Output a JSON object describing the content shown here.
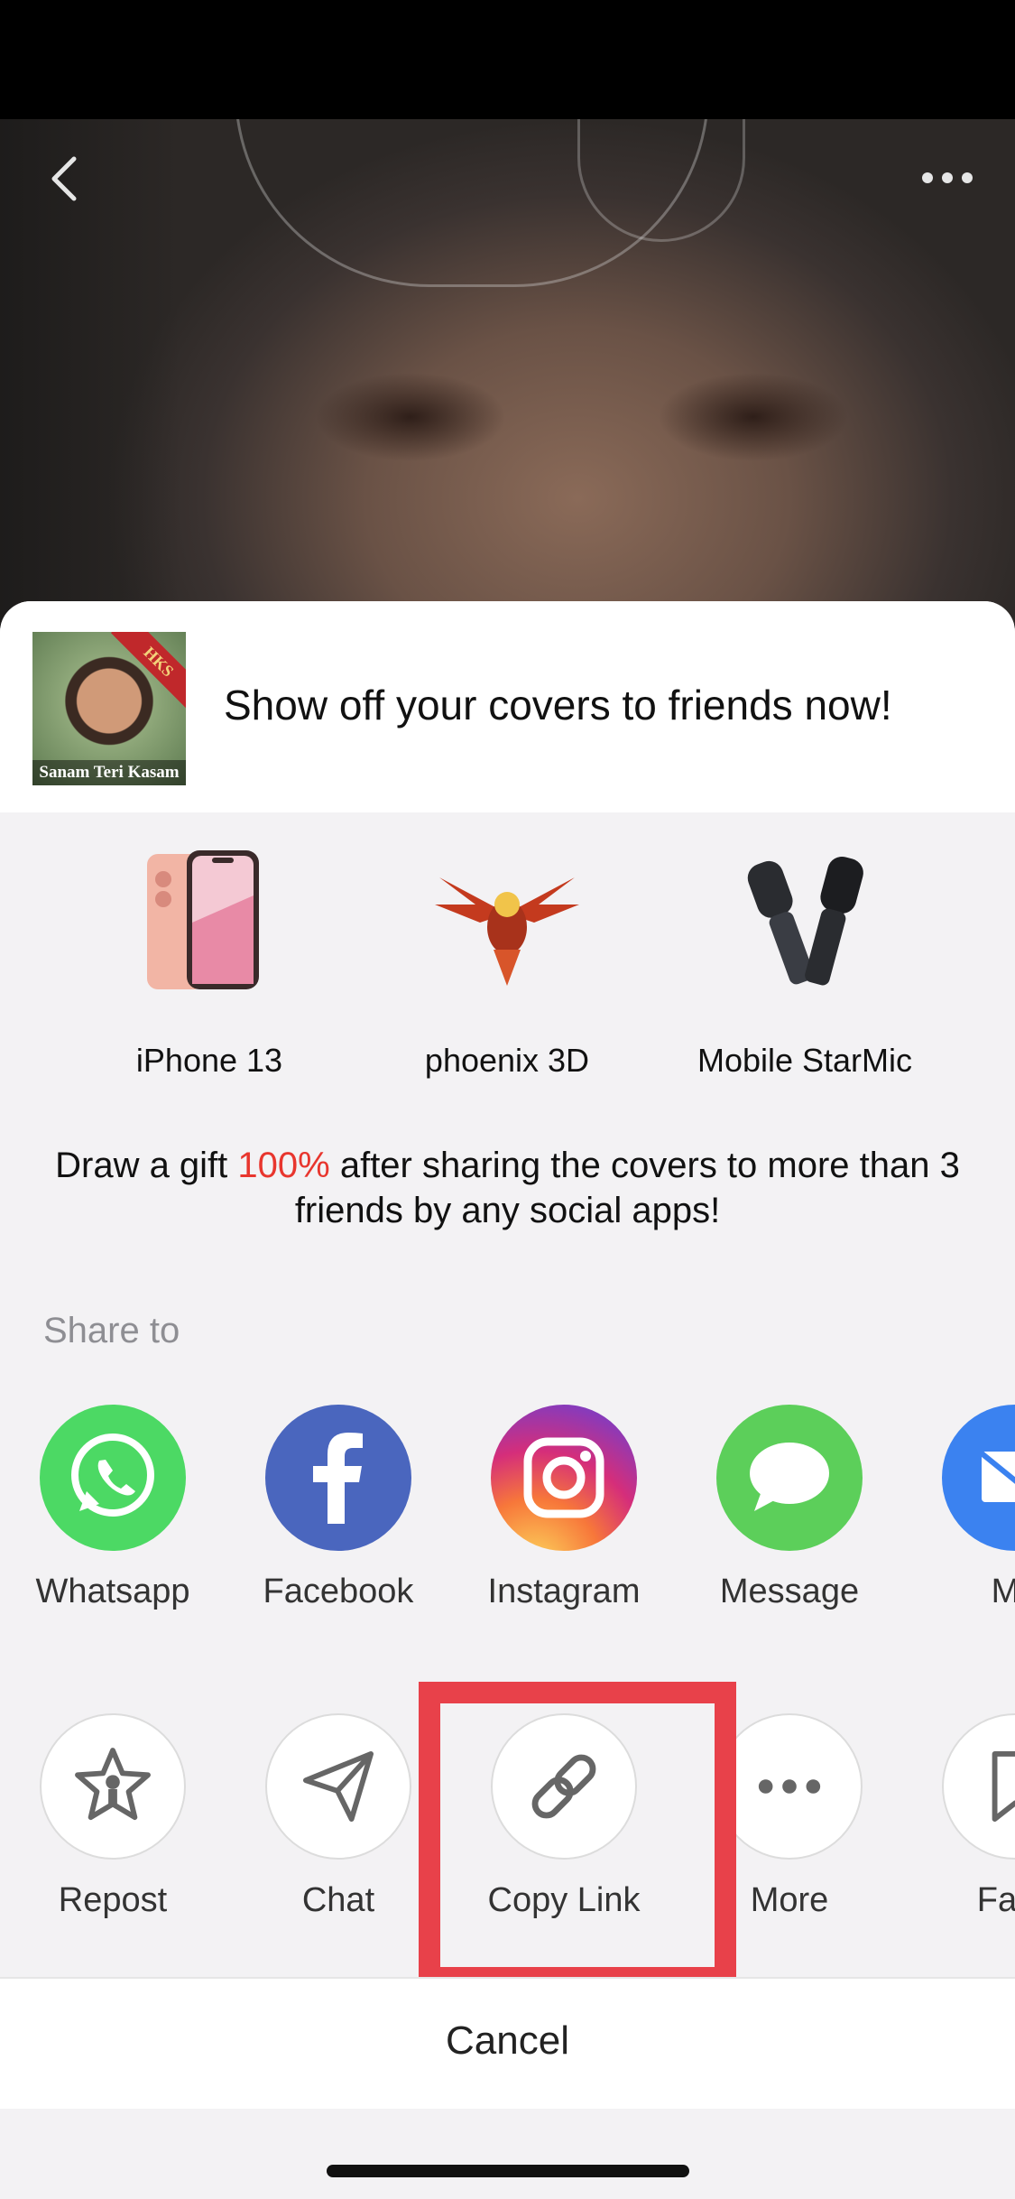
{
  "promo": {
    "cover_ribbon": "HKS",
    "cover_title": "Sanam Teri Kasam",
    "headline": "Show off your covers to friends now!"
  },
  "gifts": [
    {
      "label": "iPhone 13"
    },
    {
      "label": "phoenix 3D"
    },
    {
      "label": "Mobile StarMic"
    }
  ],
  "draw": {
    "prefix": "Draw a gift ",
    "percent": "100%",
    "suffix": " after sharing the covers to more than 3 friends by any social apps!"
  },
  "share_to": "Share to",
  "apps": [
    {
      "label": "Whatsapp",
      "icon": "whatsapp-icon",
      "color": "#4cd964"
    },
    {
      "label": "Facebook",
      "icon": "facebook-icon",
      "color": "#4a66be"
    },
    {
      "label": "Instagram",
      "icon": "instagram-icon",
      "color": "#c13584"
    },
    {
      "label": "Message",
      "icon": "message-icon",
      "color": "#5ccf5a"
    },
    {
      "label": "Ma",
      "icon": "mail-icon",
      "color": "#3b82f0"
    }
  ],
  "actions": [
    {
      "label": "Repost",
      "icon": "repost-star-icon"
    },
    {
      "label": "Chat",
      "icon": "send-icon"
    },
    {
      "label": "Copy Link",
      "icon": "link-icon"
    },
    {
      "label": "More",
      "icon": "more-icon"
    },
    {
      "label": "Favo",
      "icon": "favorite-icon"
    }
  ],
  "cancel": "Cancel",
  "colors": {
    "accent_red": "#e8362e",
    "highlight": "#e8414a",
    "sheet_bg": "#f3f2f4"
  }
}
